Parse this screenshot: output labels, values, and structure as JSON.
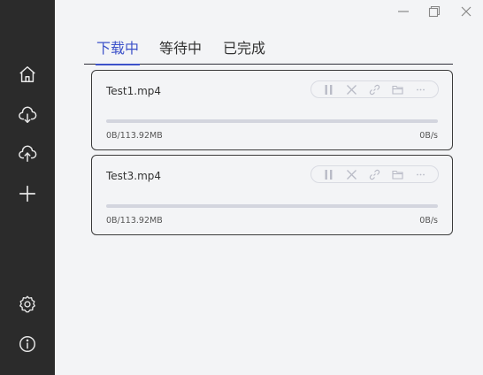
{
  "window": {
    "minimize_icon": "minimize-icon",
    "restore_icon": "restore-icon",
    "close_icon": "close-icon"
  },
  "sidebar": {
    "items": [
      {
        "icon": "home-icon"
      },
      {
        "icon": "cloud-download-icon"
      },
      {
        "icon": "cloud-upload-icon"
      },
      {
        "icon": "plus-icon"
      },
      {
        "icon": "gear-icon"
      },
      {
        "icon": "info-icon"
      }
    ]
  },
  "tabs": [
    {
      "label": "下载中",
      "active": true
    },
    {
      "label": "等待中",
      "active": false
    },
    {
      "label": "已完成",
      "active": false
    }
  ],
  "downloads": [
    {
      "name": "Test1.mp4",
      "size": "0B/113.92MB",
      "speed": "0B/s",
      "progress": 0
    },
    {
      "name": "Test3.mp4",
      "size": "0B/113.92MB",
      "speed": "0B/s",
      "progress": 0
    }
  ],
  "colors": {
    "accent": "#3d52c9",
    "sidebar_bg": "#2b2b2b",
    "page_bg": "#f3f4f6"
  }
}
